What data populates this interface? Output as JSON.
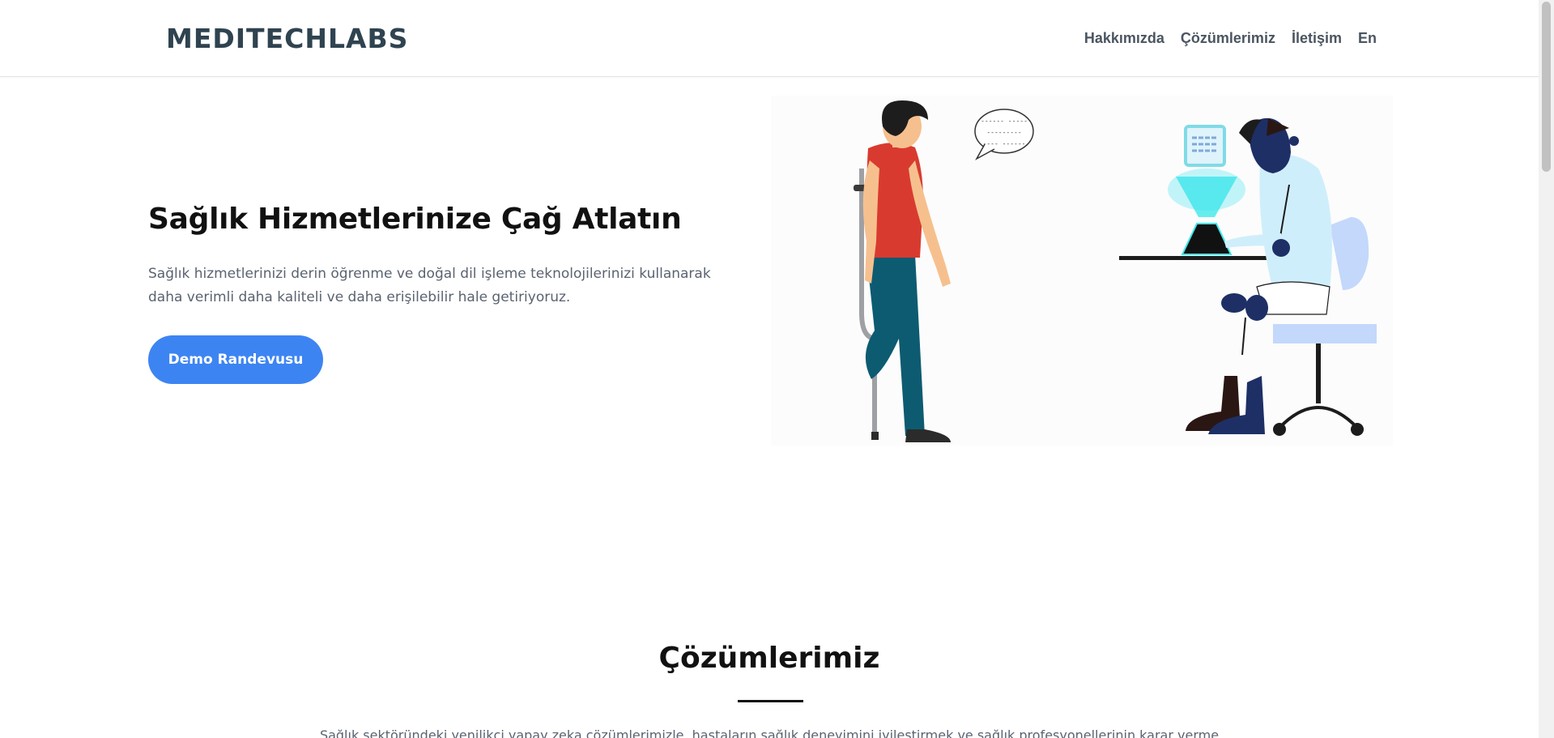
{
  "header": {
    "logo": "MEDITECHLABS",
    "nav": [
      "Hakkımızda",
      "Çözümlerimiz",
      "İletişim",
      "En"
    ]
  },
  "hero": {
    "title": "Sağlık Hizmetlerinize Çağ Atlatın",
    "text": "Sağlık hizmetlerinizi derin öğrenme ve doğal dil işleme teknolojilerinizi kullanarak daha verimli daha kaliteli ve daha erişilebilir hale getiriyoruz.",
    "button": "Demo Randevusu",
    "bubble_lines": [
      "------ -----",
      "---------",
      "---- ------"
    ]
  },
  "solutions": {
    "title": "Çözümlerimiz",
    "subtitle": "Sağlık sektöründeki yenilikçi yapay zeka çözümlerimizle, hastaların sağlık deneyimini iyileştirmek ve sağlık profesyonellerinin karar verme"
  },
  "colors": {
    "accent": "#3d84f3",
    "logo": "#2f4350",
    "nav": "#4b5561"
  }
}
